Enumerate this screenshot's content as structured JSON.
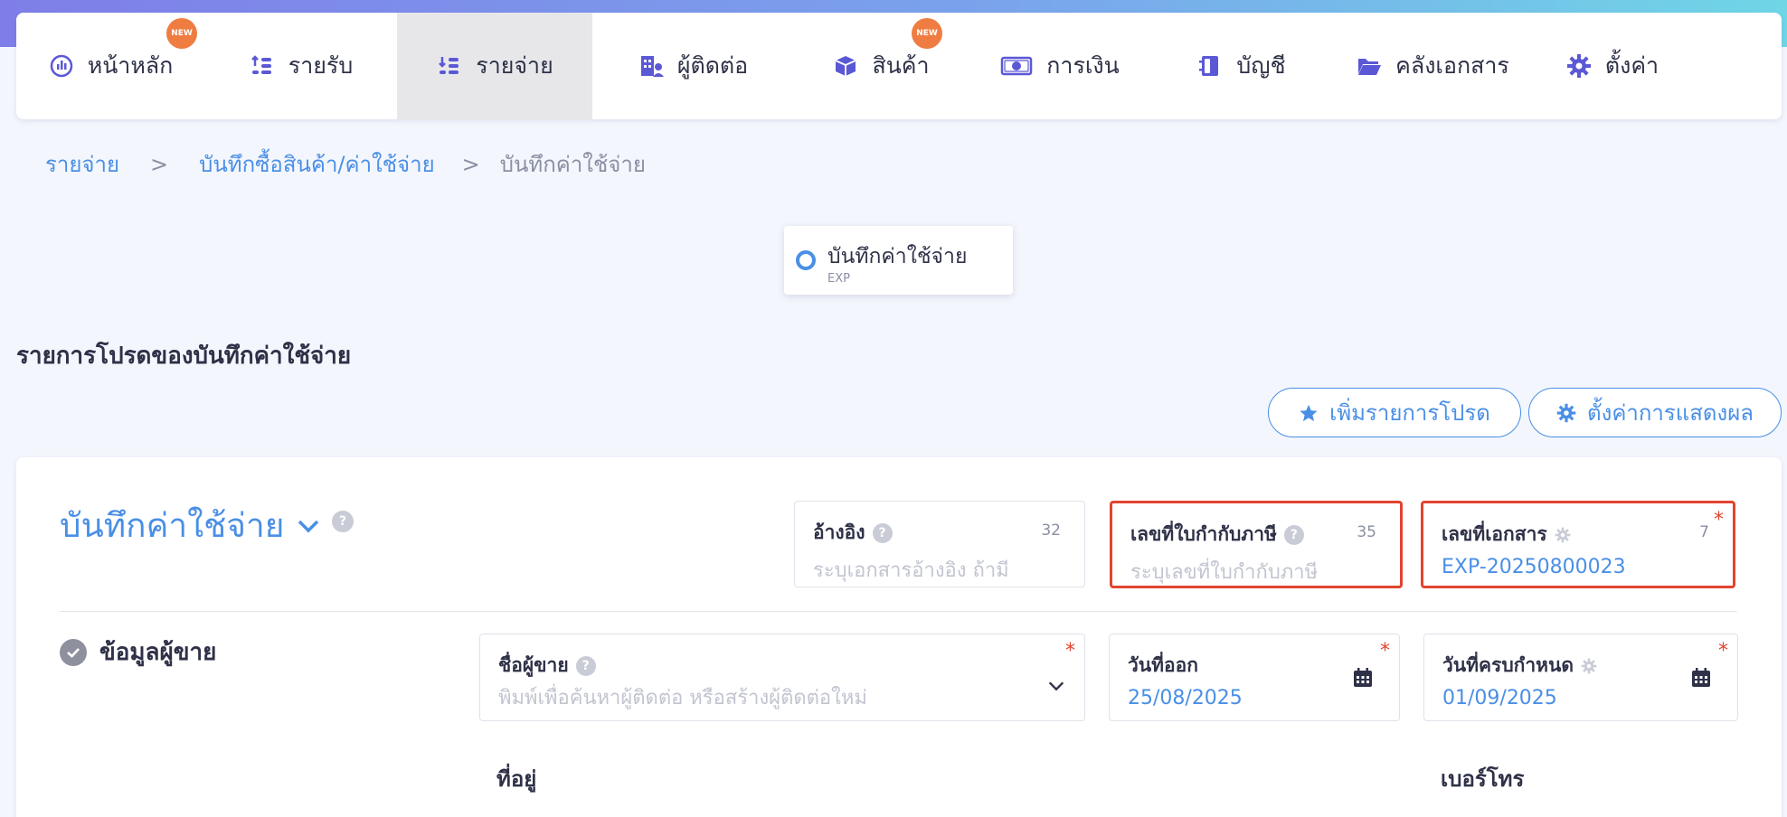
{
  "nav": {
    "items": [
      {
        "label": "หน้าหลัก",
        "icon": "dashboard-icon",
        "badge": "NEW",
        "active": false
      },
      {
        "label": "รายรับ",
        "icon": "income-icon",
        "badge": "",
        "active": false
      },
      {
        "label": "รายจ่าย",
        "icon": "expense-icon",
        "badge": "",
        "active": true
      },
      {
        "label": "ผู้ติดต่อ",
        "icon": "contacts-icon",
        "badge": "",
        "active": false
      },
      {
        "label": "สินค้า",
        "icon": "product-box-icon",
        "badge": "NEW",
        "active": false
      },
      {
        "label": "การเงิน",
        "icon": "money-icon",
        "badge": "",
        "active": false
      },
      {
        "label": "บัญชี",
        "icon": "ledger-icon",
        "badge": "",
        "active": false
      },
      {
        "label": "คลังเอกสาร",
        "icon": "folder-icon",
        "badge": "",
        "active": false
      },
      {
        "label": "ตั้งค่า",
        "icon": "gear-icon",
        "badge": "",
        "active": false
      }
    ]
  },
  "breadcrumb": {
    "level1": "รายจ่าย",
    "sep": ">",
    "level2": "บันทึกซื้อสินค้า/ค่าใช้จ่าย",
    "current": "บันทึกค่าใช้จ่าย"
  },
  "doctype": {
    "title": "บันทึกค่าใช้จ่าย",
    "code": "EXP"
  },
  "favorites": {
    "heading": "รายการโปรดของบันทึกค่าใช้จ่าย",
    "add_label": "เพิ่มรายการโปรด",
    "settings_label": "ตั้งค่าการแสดงผล"
  },
  "form": {
    "doc_title": "บันทึกค่าใช้จ่าย",
    "help_glyph": "?",
    "required_mark": "*",
    "reference": {
      "label": "อ้างอิง",
      "counter": "32",
      "placeholder": "ระบุเอกสารอ้างอิง ถ้ามี"
    },
    "tax_invoice": {
      "label": "เลขที่ใบกำกับภาษี",
      "counter": "35",
      "placeholder": "ระบุเลขที่ใบกำกับภาษี"
    },
    "doc_number": {
      "label": "เลขที่เอกสาร",
      "counter": "7",
      "value": "EXP-20250800023"
    },
    "vendor_section": {
      "title": "ข้อมูลผู้ขาย"
    },
    "vendor_name": {
      "label": "ชื่อผู้ขาย",
      "placeholder": "พิมพ์เพื่อค้นหาผู้ติดต่อ หรือสร้างผู้ติดต่อใหม่"
    },
    "issue_date": {
      "label": "วันที่ออก",
      "value": "25/08/2025"
    },
    "due_date": {
      "label": "วันที่ครบกำหนด",
      "value": "01/09/2025"
    },
    "address_label": "ที่อยู่",
    "phone_label": "เบอร์โทร"
  },
  "colors": {
    "accent": "#4a8fe6",
    "highlight": "#e2442f",
    "badge": "#ef7d42",
    "nav_icon": "#5b58d6"
  }
}
